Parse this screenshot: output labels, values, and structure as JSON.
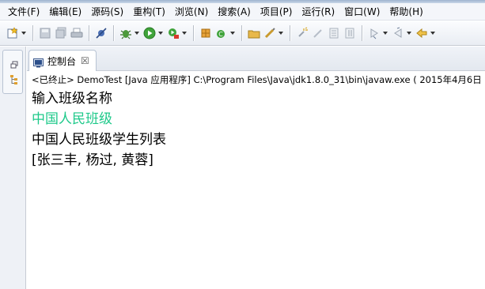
{
  "menu": [
    {
      "label": "文件(F)"
    },
    {
      "label": "编辑(E)"
    },
    {
      "label": "源码(S)"
    },
    {
      "label": "重构(T)"
    },
    {
      "label": "浏览(N)"
    },
    {
      "label": "搜索(A)"
    },
    {
      "label": "项目(P)"
    },
    {
      "label": "运行(R)"
    },
    {
      "label": "窗口(W)"
    },
    {
      "label": "帮助(H)"
    }
  ],
  "console": {
    "tab_label": "控制台",
    "tab_close": "☒",
    "status": "<已终止> DemoTest [Java 应用程序] C:\\Program Files\\Java\\jdk1.8.0_31\\bin\\javaw.exe ( 2015年4月6日",
    "lines": [
      {
        "text": "输入班级名称",
        "color": "#000000"
      },
      {
        "text": "中国人民班级",
        "color": "#1ec98a"
      },
      {
        "text": "中国人民班级学生列表",
        "color": "#000000"
      },
      {
        "text": "[张三丰, 杨过, 黄蓉]",
        "color": "#000000"
      }
    ]
  },
  "colors": {
    "input_text": "#1ec98a",
    "output_text": "#000000"
  }
}
